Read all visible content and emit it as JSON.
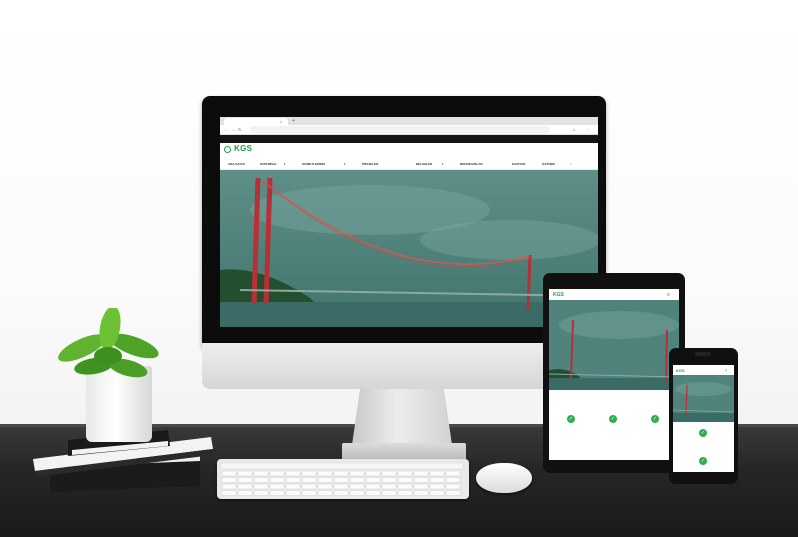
{
  "scene": {
    "description_tags": [
      "desktop-monitor",
      "tablet",
      "smartphone",
      "keyboard",
      "mouse",
      "books",
      "potted-plant"
    ]
  },
  "website": {
    "brand": "KGS",
    "brand_sub": "",
    "tab_title": "",
    "url": "",
    "phone": "",
    "nav": [
      {
        "label": "ANA SAYFA"
      },
      {
        "label": "KURUMSAL"
      },
      {
        "label": "HİZMETLERİMİZ"
      },
      {
        "label": "PROJELER"
      },
      {
        "label": "BELGELER"
      },
      {
        "label": "REFERANSLAR"
      },
      {
        "label": "KARİYER"
      },
      {
        "label": "İLETİŞİM"
      }
    ],
    "menu_icon": "hamburger-icon"
  },
  "tablet_site": {
    "feature_captions": [
      "",
      "",
      ""
    ],
    "footer_link": ""
  },
  "phone_site": {
    "feature_captions": [
      "",
      ""
    ]
  },
  "colors": {
    "brand_green": "#1d9e45",
    "hero_teal": "#4d8178",
    "bridge_red": "#c3262d",
    "desk": "#262626"
  }
}
